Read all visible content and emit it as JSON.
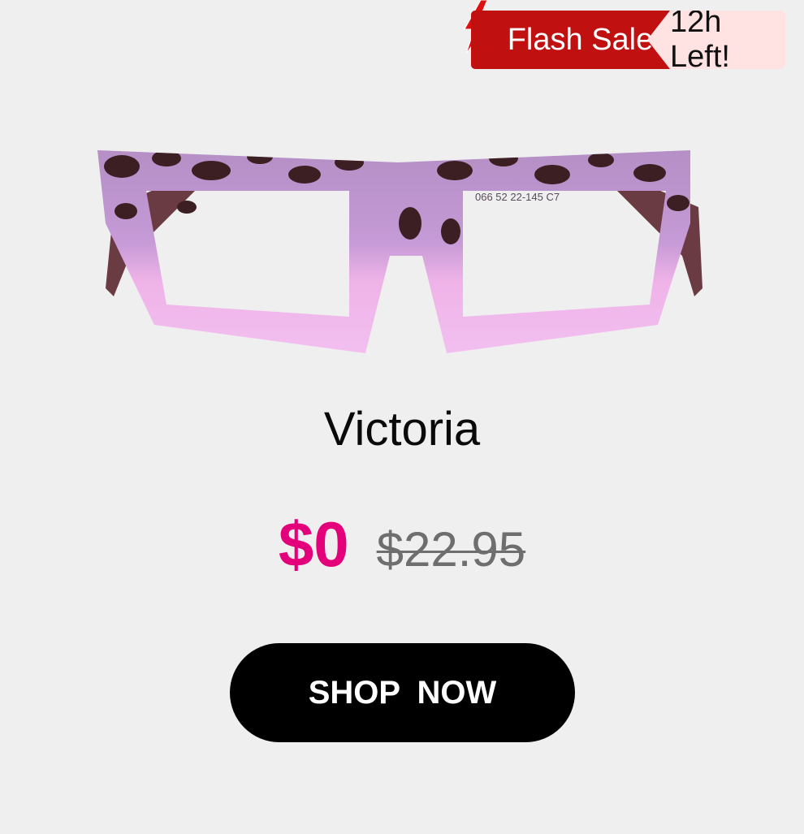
{
  "badge": {
    "label": "Flash Sale",
    "countdown": "12h Left!"
  },
  "product": {
    "name": "Victoria",
    "price": "$0",
    "original_price": "$22.95",
    "frame_inscription": "066  52  22-145  C7"
  },
  "cta": {
    "label": "SHOP  NOW"
  },
  "colors": {
    "background": "#efefef",
    "sale_red": "#c01010",
    "countdown_bg": "#ffe3e3",
    "price_accent": "#e4007a",
    "button_bg": "#000000"
  },
  "icons": {
    "badge_icon": "lightning-bolt-icon"
  }
}
